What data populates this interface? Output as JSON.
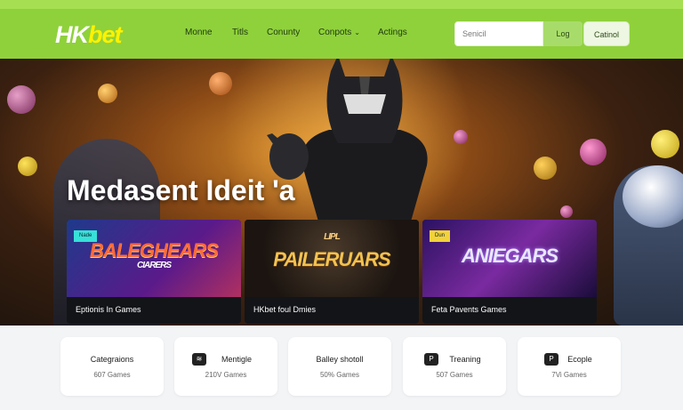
{
  "header": {
    "logo_hk": "HK",
    "logo_bet": "bet",
    "nav": [
      "Monne",
      "Titls",
      "Conunty",
      "Conpots",
      "Actings"
    ],
    "search_placeholder": "Senicil",
    "login_label": "Log",
    "action_label": "Catinol"
  },
  "hero": {
    "title": "Medasent Ideit 'a"
  },
  "games": [
    {
      "art_title": "BALEGHEARS",
      "art_sub": "CIARERS",
      "badge": "Nade",
      "label": "Eptionis In Games"
    },
    {
      "art_title": "PAILERUARS",
      "art_sub": "LIPL",
      "label": "HKbet foul Dmies"
    },
    {
      "art_title": "ANIEGARS",
      "badge": "Dun",
      "label": "Feta Pavents Games"
    }
  ],
  "categories": [
    {
      "title": "Categraions",
      "count": "607 Games",
      "icon": ""
    },
    {
      "title": "Mentigle",
      "count": "210V Games",
      "icon": "wifi-icon"
    },
    {
      "title": "Balley shotoll",
      "count": "50% Games",
      "icon": ""
    },
    {
      "title": "Treaning",
      "count": "507 Games",
      "icon": "pj-icon"
    },
    {
      "title": "Ecople",
      "count": "7Vi Games",
      "icon": "p-icon"
    }
  ],
  "colors": {
    "header": "#8fd13b",
    "accent": "#fff200"
  }
}
